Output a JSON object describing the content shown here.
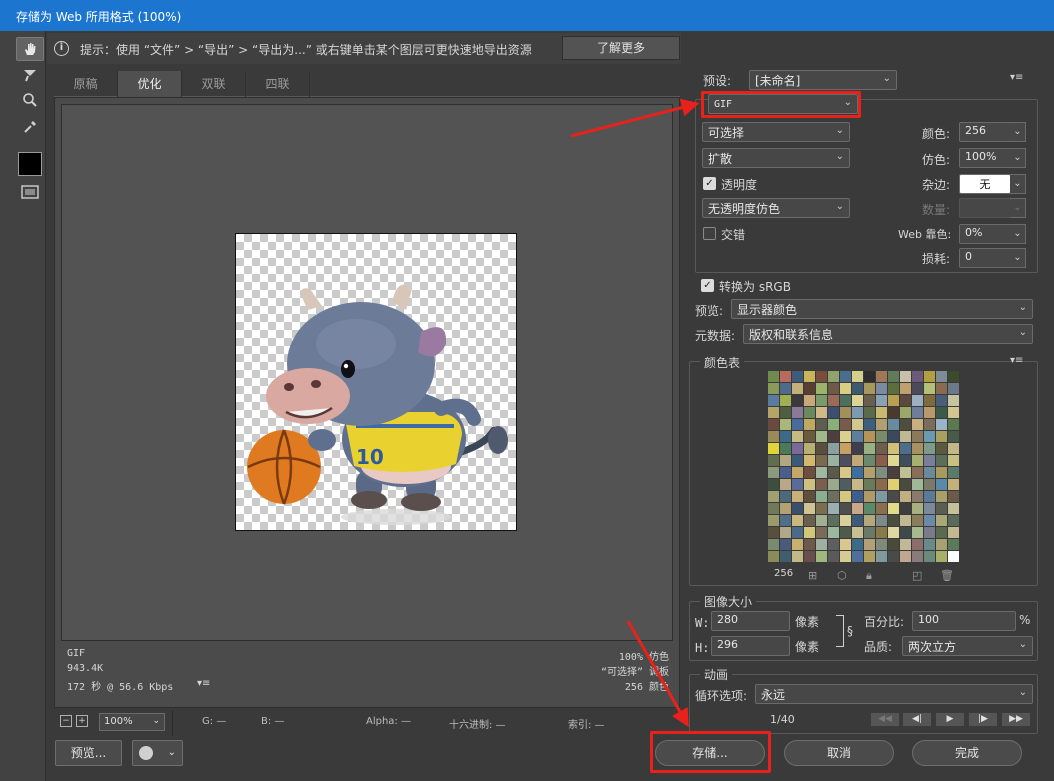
{
  "window": {
    "title": "存储为 Web 所用格式 (100%)"
  },
  "info": {
    "text": "提示：使用 “文件” > “导出” > “导出为...” 或右键单击某个图层可更快速地导出资源",
    "learn_more": "了解更多"
  },
  "tabs": [
    {
      "label": "原稿",
      "active": false
    },
    {
      "label": "优化",
      "active": true
    },
    {
      "label": "双联",
      "active": false
    },
    {
      "label": "四联",
      "active": false
    }
  ],
  "canvas_status": {
    "format": "GIF",
    "size": "943.4K",
    "time": "172 秒 @ 56.6 Kbps",
    "dither": "100% 仿色",
    "palette": "“可选择” 调板",
    "colors": "256 颜色"
  },
  "bottom": {
    "zoom": "100%",
    "readout_g": "G: —",
    "readout_b": "B: —",
    "readout_alpha": "Alpha: —",
    "readout_hex": "十六进制: —",
    "readout_index": "索引: —",
    "preview_button": "预览...",
    "save_button": "存储...",
    "cancel_button": "取消",
    "done_button": "完成"
  },
  "settings": {
    "preset_label": "预设:",
    "preset_value": "[未命名]",
    "format": "GIF",
    "reduction": "可选择",
    "dither_algorithm": "扩散",
    "transparency_label": "透明度",
    "transparency_checked": true,
    "matte_dither": "无透明度仿色",
    "interlaced_label": "交错",
    "interlaced_checked": false,
    "colors_label": "颜色:",
    "colors_value": "256",
    "dither_label": "仿色:",
    "dither_value": "100%",
    "matte_label": "杂边:",
    "matte_value": "无",
    "amount_label": "数量:",
    "web_snap_label": "Web 靠色:",
    "web_snap_value": "0%",
    "lossy_label": "损耗:",
    "lossy_value": "0",
    "convert_srgb_label": "转换为 sRGB",
    "convert_srgb_checked": true,
    "preview_label": "预览:",
    "preview_value": "显示器颜色",
    "metadata_label": "元数据:",
    "metadata_value": "版权和联系信息"
  },
  "color_table": {
    "title": "颜色表",
    "count": "256",
    "colors": [
      "#6f8a4e",
      "#b86b5c",
      "#3d5b7a",
      "#c9b45a",
      "#7a4e3c",
      "#8fa46a",
      "#4a6e8f",
      "#d4cf8a",
      "#2e2e2e",
      "#a07858",
      "#5f7c5a",
      "#c8c0a8",
      "#6b5a7a",
      "#b0a040",
      "#7e8c9a",
      "#3c4a2e",
      "#8a9a5a",
      "#4f6a8a",
      "#c4b078",
      "#5a3e34",
      "#9ab46a",
      "#6e5a48",
      "#d8d080",
      "#3e5a6e",
      "#a8985c",
      "#7a8aa0",
      "#5c6e3e",
      "#c0a070",
      "#4a4a5a",
      "#b4c07a",
      "#8a6a50",
      "#6a7a8a",
      "#5a7aa0",
      "#a0b050",
      "#3a3a3a",
      "#c8a878",
      "#7a9a6a",
      "#9a6a5a",
      "#4e6e5e",
      "#dcd494",
      "#6a5e4e",
      "#8aa0b4",
      "#b8a050",
      "#5a4a3e",
      "#9ab0c0",
      "#7e6a3e",
      "#4a5e7a",
      "#c4c4a0",
      "#b4a46a",
      "#4e5e3e",
      "#8a7a9a",
      "#6a8a5e",
      "#d0b888",
      "#3e4e6e",
      "#a0905a",
      "#7e9ab0",
      "#5a6a4a",
      "#c8b870",
      "#4a3a2e",
      "#9aa86a",
      "#6e7e9a",
      "#b89a6a",
      "#3a5a4a",
      "#d4c490",
      "#6a4a3e",
      "#a8b878",
      "#4a6a9a",
      "#c0a860",
      "#5e5e4e",
      "#8ab07a",
      "#7a5a4a",
      "#d0c890",
      "#3e5e7e",
      "#b0a070",
      "#6a8aa0",
      "#4e4e3e",
      "#c8b080",
      "#7a6e5a",
      "#9ab4c8",
      "#5a7a4e",
      "#9a8a5a",
      "#3e6a8a",
      "#c4bc80",
      "#6a5a3e",
      "#a0b88a",
      "#4e3e3e",
      "#d8d090",
      "#5e7e9e",
      "#b4945a",
      "#7a8a6a",
      "#3a4a5a",
      "#c0b890",
      "#8a7a5a",
      "#6a9ab0",
      "#a8a060",
      "#4a5a4a",
      "#e0d43a",
      "#4a7a5a",
      "#7a6a9a",
      "#b8b070",
      "#5a4e3e",
      "#8aa0a0",
      "#c8a060",
      "#3e3e4e",
      "#9ab080",
      "#6e5e4e",
      "#d0c078",
      "#4e6e8e",
      "#a89060",
      "#7e9a8a",
      "#5a5a3e",
      "#c4b888",
      "#5e6e4e",
      "#b0a880",
      "#3a5a7a",
      "#d4b870",
      "#7a6a4e",
      "#9ab0a0",
      "#4e4e5e",
      "#c0a878",
      "#6a8a6e",
      "#8a5e4a",
      "#e0d890",
      "#3e4e5e",
      "#a8b070",
      "#7a7e9a",
      "#5a6e5a",
      "#c8c080",
      "#8a9a7a",
      "#4a5e8a",
      "#c4a868",
      "#6e4e3e",
      "#a0b8a0",
      "#5a5a4a",
      "#d8c888",
      "#3e6e9e",
      "#b4a068",
      "#7e8e7e",
      "#4a3e3e",
      "#c0c090",
      "#8a6e5a",
      "#6a8a9a",
      "#a89a5a",
      "#5a7a6a",
      "#3e4e3e",
      "#b8a888",
      "#5a6a9a",
      "#d0c080",
      "#7a5e4e",
      "#9aa890",
      "#4e5e5e",
      "#c8b888",
      "#6a7a5a",
      "#8a6a4a",
      "#e0d070",
      "#4a4a3e",
      "#a0b898",
      "#7a7a6a",
      "#5a8aaa",
      "#c4b078",
      "#a0a070",
      "#4a6a7a",
      "#c8b078",
      "#5e4e3e",
      "#8ab090",
      "#6e6e5e",
      "#d4c880",
      "#3e5e8e",
      "#b09a6a",
      "#7e9aa0",
      "#4a4a4a",
      "#c0b080",
      "#8a7a6a",
      "#5a7a9a",
      "#a8a068",
      "#6a5a4a",
      "#6e7a5a",
      "#b4a070",
      "#3a4e6e",
      "#d0c490",
      "#7a6e4e",
      "#9ab0b0",
      "#4e4e4e",
      "#c8a888",
      "#5a8a6a",
      "#8a6e4e",
      "#e0dc88",
      "#3e3e3e",
      "#a8b080",
      "#7a8a9a",
      "#5a5e4e",
      "#c4c098",
      "#9a9a6a",
      "#4e6e8a",
      "#c8b880",
      "#6a5e4e",
      "#a0b090",
      "#5e6e5e",
      "#d8d098",
      "#3e5a7a",
      "#b4a878",
      "#7e8a8a",
      "#4a4e3e",
      "#c0b890",
      "#8a7e5a",
      "#6a8aa8",
      "#a8a878",
      "#5a6a5a",
      "#5a4e3e",
      "#b0a888",
      "#4a6a8a",
      "#d0c878",
      "#7a6a5a",
      "#9ab8a0",
      "#4e5a4a",
      "#c8c090",
      "#6a7a6a",
      "#8a7a4a",
      "#e0d8a0",
      "#3e4a4a",
      "#a8b890",
      "#7a7a8a",
      "#5a6a4e",
      "#c4b890",
      "#7a8a6e",
      "#4a5a7a",
      "#c8b070",
      "#6e5a4a",
      "#a0b0a0",
      "#5e5e5e",
      "#d8c890",
      "#3e6a8a",
      "#b4a078",
      "#7e8a7a",
      "#4a4a3a",
      "#c0b898",
      "#8a6e6a",
      "#6a8a8a",
      "#a8a070",
      "#5a7a5a",
      "#8a8a5a",
      "#3e5e6e",
      "#c4b888",
      "#6a4e4e",
      "#a0b880",
      "#5a5a5a",
      "#d4cc90",
      "#4e6e9e",
      "#b0a060",
      "#7e9a9a",
      "#4a4a4a",
      "#c0a890",
      "#8a7a7a",
      "#6a8a7a",
      "#a8b068",
      "#ffffff"
    ]
  },
  "image_size": {
    "title": "图像大小",
    "w_label": "W:",
    "w_value": "280",
    "h_label": "H:",
    "h_value": "296",
    "unit": "像素",
    "percent_label": "百分比:",
    "percent_value": "100",
    "percent_unit": "%",
    "quality_label": "品质:",
    "quality_value": "两次立方"
  },
  "animation": {
    "title": "动画",
    "loop_label": "循环选项:",
    "loop_value": "永远",
    "frame": "1/40"
  },
  "accent_colors": {
    "title_bar": "#1c76cf",
    "highlight": "#e8221b"
  }
}
